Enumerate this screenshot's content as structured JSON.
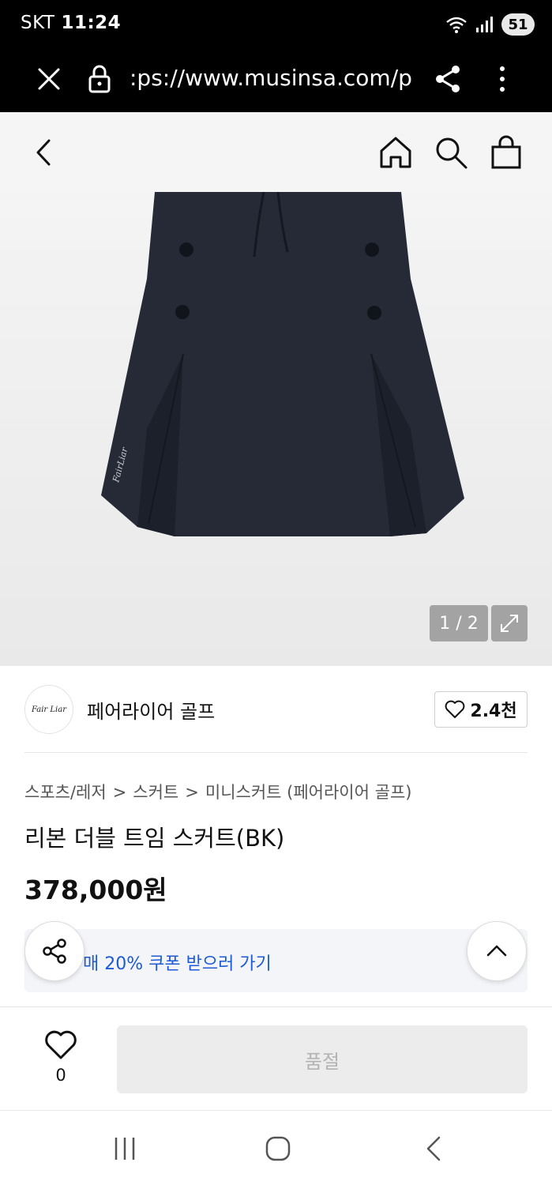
{
  "status_bar": {
    "carrier": "SKT",
    "time": "11:24",
    "battery": "51",
    "icons": [
      "wifi-icon",
      "signal-icon",
      "battery-icon"
    ]
  },
  "browser": {
    "url": ":ps://www.musinsa.com/p",
    "icons": [
      "close-icon",
      "lock-icon",
      "share-icon",
      "menu-icon"
    ]
  },
  "header": {
    "icons": [
      "back-icon",
      "home-icon",
      "search-icon",
      "shopping-bag-icon"
    ]
  },
  "gallery": {
    "counter": "1 / 2",
    "current_page": 1,
    "total_pages": 2,
    "logo_text": "FairLiar"
  },
  "brand": {
    "logo_text": "Fair Liar",
    "name": "페어라이어 골프",
    "likes": "2.4천"
  },
  "breadcrumb": {
    "items": [
      "스포츠/레저",
      "스커트",
      "미니스커트 (페어라이어 골프)"
    ],
    "separator": ">"
  },
  "product": {
    "title": "리본 더블 트임 스커트(BK)",
    "price": "378,000원"
  },
  "coupon": {
    "text": "매 20% 쿠폰 받으러 가기"
  },
  "bottom_bar": {
    "wish_count": "0",
    "soldout_label": "품절"
  },
  "colors": {
    "accent_blue": "#1e5ad6",
    "skirt": "#252a36",
    "soldout_bg": "#ececec",
    "soldout_text": "#b3b3b3"
  }
}
